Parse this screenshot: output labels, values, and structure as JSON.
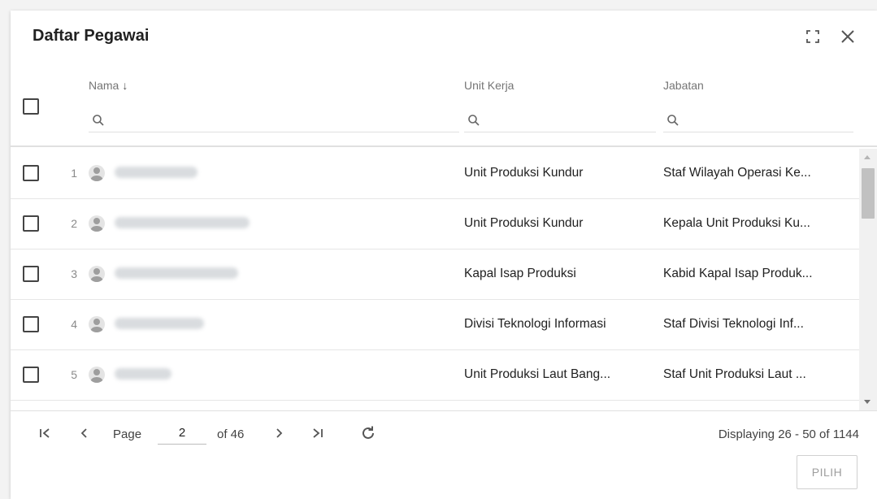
{
  "dialog": {
    "title": "Daftar Pegawai"
  },
  "columns": {
    "nama": "Nama",
    "unit_kerja": "Unit Kerja",
    "jabatan": "Jabatan"
  },
  "rows": [
    {
      "num": "1",
      "unit": "Unit Produksi Kundur",
      "jabatan": "Staf Wilayah Operasi Ke..."
    },
    {
      "num": "2",
      "unit": "Unit Produksi Kundur",
      "jabatan": "Kepala Unit Produksi Ku..."
    },
    {
      "num": "3",
      "unit": "Kapal Isap Produksi",
      "jabatan": "Kabid Kapal Isap Produk..."
    },
    {
      "num": "4",
      "unit": "Divisi Teknologi Informasi",
      "jabatan": "Staf Divisi Teknologi Inf..."
    },
    {
      "num": "5",
      "unit": "Unit Produksi Laut Bang...",
      "jabatan": "Staf Unit Produksi Laut ..."
    }
  ],
  "pager": {
    "page_label": "Page",
    "page_value": "2",
    "of_label": "of 46",
    "display_text": "Displaying 26 - 50 of 1144"
  },
  "footer": {
    "pilih_label": "PILIH"
  },
  "icons": {
    "maximize": "maximize-icon",
    "close": "close-icon",
    "sort": "arrow-down-icon",
    "search": "search-icon",
    "avatar": "user-icon",
    "first": "first-page-icon",
    "prev": "chevron-left-icon",
    "next": "chevron-right-icon",
    "last": "last-page-icon",
    "refresh": "refresh-icon"
  },
  "colors": {
    "text": "#212121",
    "muted": "#757575",
    "border": "#e0e0e0"
  }
}
